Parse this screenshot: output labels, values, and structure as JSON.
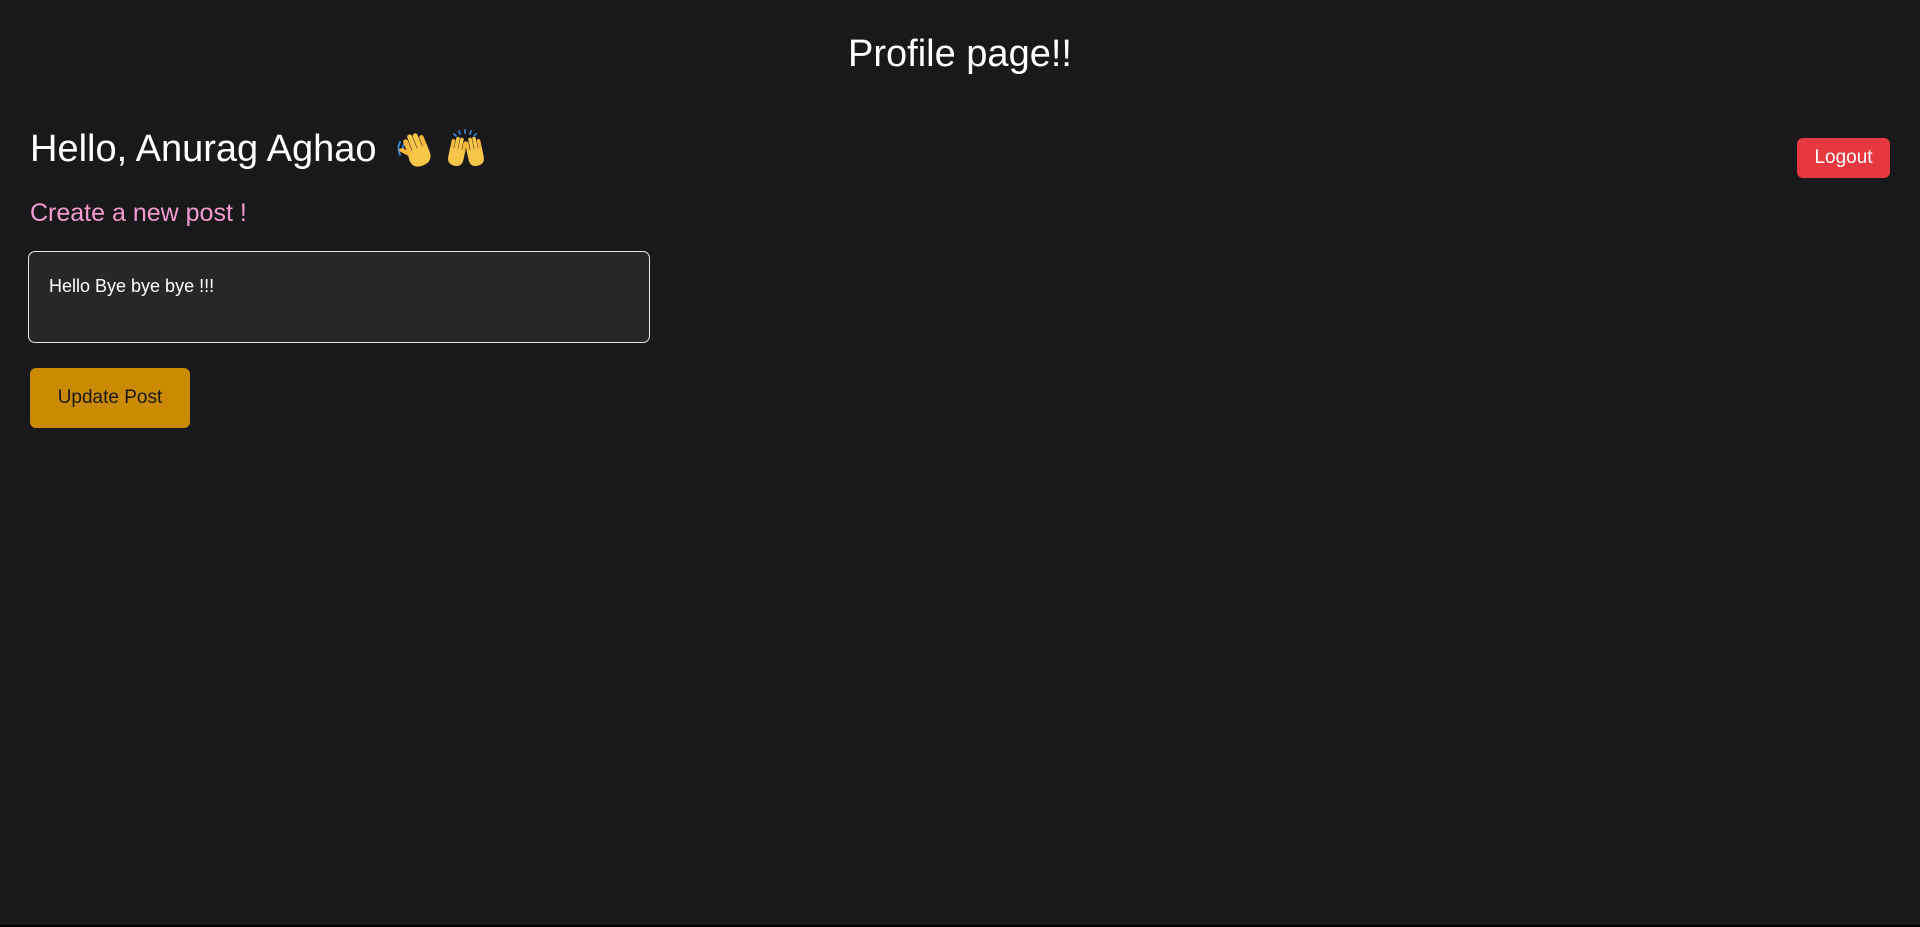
{
  "header": {
    "title": "Profile page!!"
  },
  "profile": {
    "greeting": "Hello, Anurag Aghao",
    "emojis": [
      "waving-hand-icon",
      "raising-hands-icon"
    ]
  },
  "actions": {
    "logout_label": "Logout"
  },
  "post_form": {
    "heading": "Create a new post !",
    "textarea_value": "Hello Bye bye bye !!!",
    "submit_label": "Update Post"
  },
  "colors": {
    "background": "#19191b",
    "logout_button": "#e5393f",
    "update_button": "#ca8a04",
    "subheading": "#f39bd0",
    "textarea_bg": "#27272a"
  }
}
